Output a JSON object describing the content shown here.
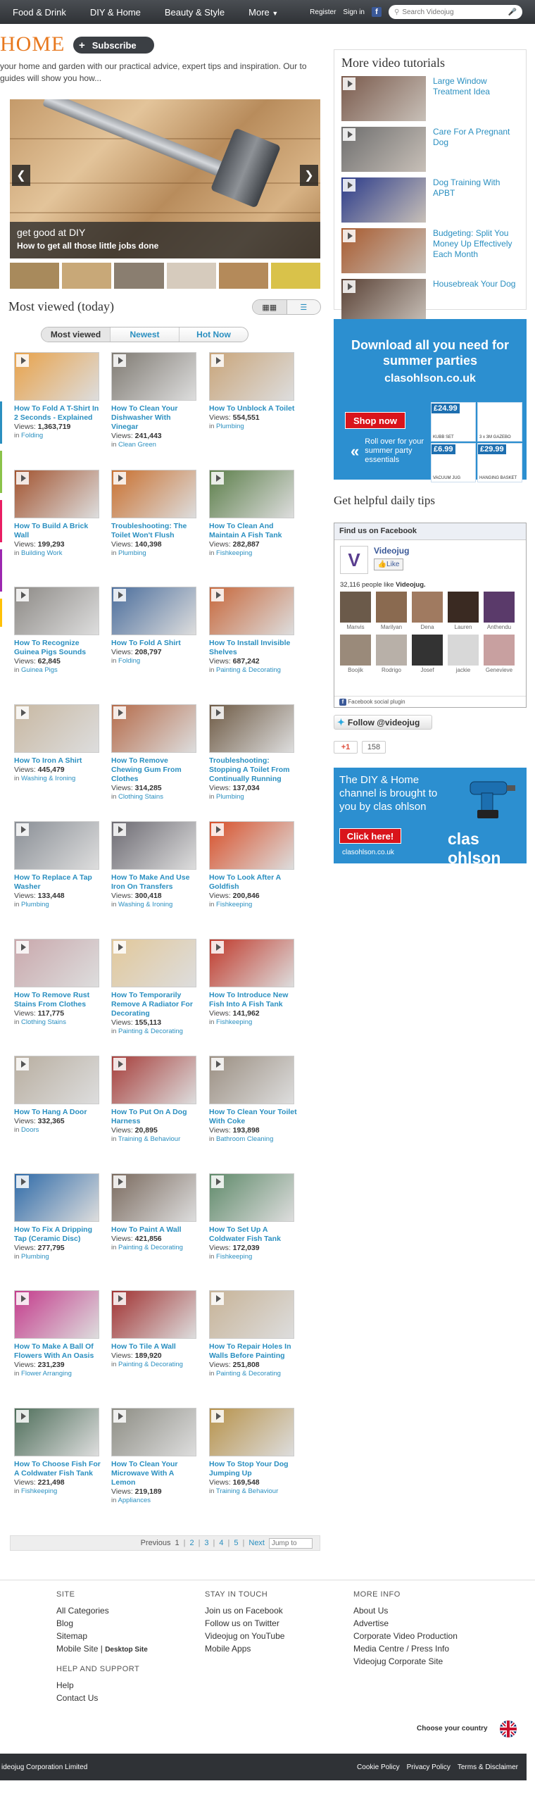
{
  "nav": {
    "items": [
      "Food & Drink",
      "DIY & Home",
      "Beauty & Style",
      "More"
    ],
    "register": "Register",
    "signin": "Sign in",
    "search_placeholder": "Search Videojug"
  },
  "header": {
    "title": "HOME",
    "subscribe": "Subscribe",
    "intro": "your home and garden with our practical advice, expert tips and inspiration. Our to guides will show you how..."
  },
  "slideshow": {
    "caption_title": "get good at DIY",
    "caption_sub": "How to get all those little jobs done"
  },
  "most_viewed": {
    "title": "Most viewed (today)",
    "tabs": [
      "Most viewed",
      "Newest",
      "Hot Now"
    ],
    "videos": [
      {
        "title": "How To Fold A T-Shirt In 2 Seconds - Explained",
        "views": "1,363,719",
        "category": "Folding",
        "thumb": "#e8a24a"
      },
      {
        "title": "How To Clean Your Dishwasher With Vinegar",
        "views": "241,443",
        "category": "Clean Green",
        "thumb": "#7f7a72"
      },
      {
        "title": "How To Unblock A Toilet",
        "views": "554,551",
        "category": "Plumbing",
        "thumb": "#c9a57a"
      },
      {
        "title": "How To Build A Brick Wall",
        "views": "199,293",
        "category": "Building Work",
        "thumb": "#a2532f"
      },
      {
        "title": "Troubleshooting: The Toilet Won't Flush",
        "views": "140,398",
        "category": "Plumbing",
        "thumb": "#c9702f"
      },
      {
        "title": "How To Clean And Maintain A Fish Tank",
        "views": "282,887",
        "category": "Fishkeeping",
        "thumb": "#5c7f4a"
      },
      {
        "title": "How To Recognize Guinea Pigs Sounds",
        "views": "62,845",
        "category": "Guinea Pigs",
        "thumb": "#8d8a86"
      },
      {
        "title": "How To Fold A Shirt",
        "views": "208,797",
        "category": "Folding",
        "thumb": "#4a6d9c"
      },
      {
        "title": "How To Install Invisible Shelves",
        "views": "687,242",
        "category": "Painting & Decorating",
        "thumb": "#c7683c"
      },
      {
        "title": "How To Iron A Shirt",
        "views": "445,479",
        "category": "Washing & Ironing",
        "thumb": "#c8b8a2"
      },
      {
        "title": "How To Remove Chewing Gum From Clothes",
        "views": "314,285",
        "category": "Clothing Stains",
        "thumb": "#b56b4a"
      },
      {
        "title": "Troubleshooting: Stopping A Toilet From Continually Running",
        "views": "137,034",
        "category": "Plumbing",
        "thumb": "#6e5a44"
      },
      {
        "title": "How To Replace A Tap Washer",
        "views": "133,448",
        "category": "Plumbing",
        "thumb": "#8a8f96"
      },
      {
        "title": "How To Make And Use Iron On Transfers",
        "views": "300,418",
        "category": "Washing & Ironing",
        "thumb": "#6c6a72"
      },
      {
        "title": "How To Look After A Goldfish",
        "views": "200,846",
        "category": "Fishkeeping",
        "thumb": "#d8502a"
      },
      {
        "title": "How To Remove Rust Stains From Clothes",
        "views": "117,775",
        "category": "Clothing Stains",
        "thumb": "#c9a8ac"
      },
      {
        "title": "How To Temporarily Remove A Radiator For Decorating",
        "views": "155,113",
        "category": "Painting & Decorating",
        "thumb": "#e2c89a"
      },
      {
        "title": "How To Introduce New Fish Into A Fish Tank",
        "views": "141,962",
        "category": "Fishkeeping",
        "thumb": "#c0392b"
      },
      {
        "title": "How To Hang A Door",
        "views": "332,365",
        "category": "Doors",
        "thumb": "#b8aea0"
      },
      {
        "title": "How To Put On A Dog Harness",
        "views": "20,895",
        "category": "Training & Behaviour",
        "thumb": "#a63d3a"
      },
      {
        "title": "How To Clean Your Toilet With Coke",
        "views": "193,898",
        "category": "Bathroom Cleaning",
        "thumb": "#9b8f82"
      },
      {
        "title": "How To Fix A Dripping Tap (Ceramic Disc)",
        "views": "277,795",
        "category": "Plumbing",
        "thumb": "#2e6aa8"
      },
      {
        "title": "How To Paint A Wall",
        "views": "421,856",
        "category": "Painting & Decorating",
        "thumb": "#7a6a5e"
      },
      {
        "title": "How To Set Up A Coldwater Fish Tank",
        "views": "172,039",
        "category": "Fishkeeping",
        "thumb": "#5f8a6a"
      },
      {
        "title": "How To Make A Ball Of Flowers With An Oasis",
        "views": "231,239",
        "category": "Flower Arranging",
        "thumb": "#c43b8c"
      },
      {
        "title": "How To Tile A Wall",
        "views": "189,920",
        "category": "Painting & Decorating",
        "thumb": "#a03030"
      },
      {
        "title": "How To Repair Holes In Walls Before Painting",
        "views": "251,808",
        "category": "Painting & Decorating",
        "thumb": "#c7b397"
      },
      {
        "title": "How To Choose Fish For A Coldwater Fish Tank",
        "views": "221,498",
        "category": "Fishkeeping",
        "thumb": "#4e6e5a"
      },
      {
        "title": "How To Clean Your Microwave With A Lemon",
        "views": "219,189",
        "category": "Appliances",
        "thumb": "#8d8d84"
      },
      {
        "title": "How To Stop Your Dog Jumping Up",
        "views": "169,548",
        "category": "Training & Behaviour",
        "thumb": "#b7924a"
      }
    ],
    "views_label": "Views:",
    "in_label": "in"
  },
  "pagination": {
    "previous": "Previous",
    "pages": [
      "1",
      "2",
      "3",
      "4",
      "5"
    ],
    "next": "Next",
    "jump_placeholder": "Jump to"
  },
  "sidebar": {
    "tutorials_title": "More video tutorials",
    "tutorials": [
      {
        "title": "Large Window Treatment Idea",
        "thumb": "#7a5a4c"
      },
      {
        "title": "Care For A Pregnant Dog",
        "thumb": "#6e6e6e"
      },
      {
        "title": "Dog Training With APBT",
        "thumb": "#2a3a8a"
      },
      {
        "title": "Budgeting: Split You Money Up Effectively Each Month",
        "thumb": "#a85a2e"
      },
      {
        "title": "Housebreak Your Dog",
        "thumb": "#5a4236"
      }
    ],
    "ad1": {
      "headline": "Download all you need for summer parties",
      "url": "clasohlson.co.uk",
      "shop": "Shop now",
      "roll": "Roll over for your summer party essentials",
      "prices": [
        "£24.99",
        "",
        "£6.99",
        "£29.99"
      ],
      "products": [
        "KUBB SET",
        "3 x 3M GAZEBO",
        "VACUUM JUG",
        "HANGING BASKET"
      ]
    },
    "tips_title": "Get helpful daily tips",
    "facebook": {
      "header": "Find us on Facebook",
      "page_name": "Videojug",
      "like": "Like",
      "count_prefix": "32,116 people like ",
      "count_name": "Videojug.",
      "faces": [
        "Manvis",
        "Marilyan",
        "Dena",
        "Lauren",
        "Anthendu",
        "Boojik",
        "Rodrigo",
        "Josef",
        "jackie",
        "Genevieve"
      ],
      "plugin": "Facebook social plugin"
    },
    "twitter": "Follow @videojug",
    "gplus": "+1",
    "gplus_count": "158",
    "ad2": {
      "text": "The DIY & Home channel is brought to you by clas ohlson",
      "click": "Click here!",
      "url": "clasohlson.co.uk",
      "brand": "clas ohlson"
    }
  },
  "footer": {
    "site_title": "SITE",
    "site_links": [
      "All Categories",
      "Blog",
      "Sitemap"
    ],
    "mobile_site": "Mobile Site",
    "desktop_site": "Desktop Site",
    "stay_title": "STAY IN TOUCH",
    "stay_links": [
      "Join us on Facebook",
      "Follow us on Twitter",
      "Videojug on YouTube",
      "Mobile Apps"
    ],
    "more_title": "MORE INFO",
    "more_links": [
      "About Us",
      "Advertise",
      "Corporate Video Production",
      "Media Centre / Press Info",
      "Videojug Corporate Site"
    ],
    "help_title": "HELP AND SUPPORT",
    "help_links": [
      "Help",
      "Contact Us"
    ],
    "choose_country": "Choose your country",
    "copyright": "ideojug Corporation Limited",
    "bottom_links": [
      "Cookie Policy",
      "Privacy Policy",
      "Terms & Disclaimer"
    ]
  },
  "colors": {
    "accent": "#e8781e",
    "link": "#2a8fc0",
    "nav_bg": "#2f3236",
    "ad_blue": "#2c8fd0",
    "ad_red": "#d9141b"
  }
}
